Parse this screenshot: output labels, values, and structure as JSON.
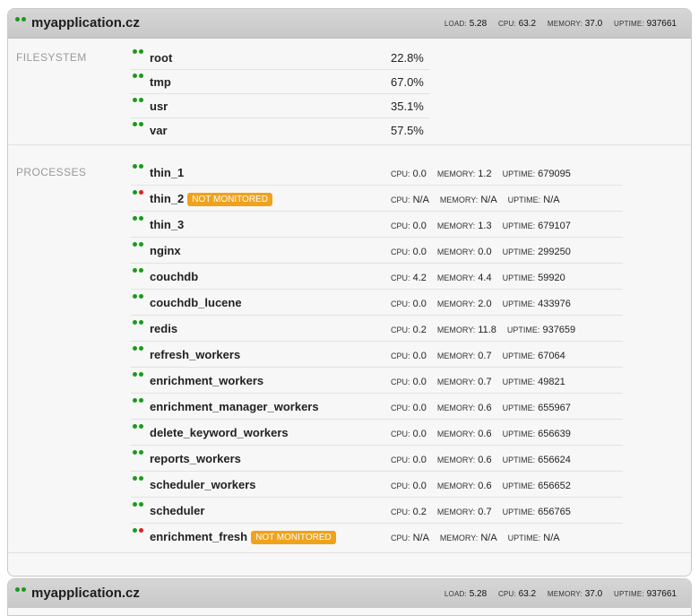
{
  "server": {
    "title": "myapplication.cz",
    "load_label": "LOAD:",
    "load": "5.28",
    "cpu_label": "CPU:",
    "cpu": "63.2",
    "memory_label": "MEMORY:",
    "memory": "37.0",
    "uptime_label": "UPTIME:",
    "uptime": "937661"
  },
  "filesystem": {
    "label": "FILESYSTEM",
    "items": [
      {
        "name": "root",
        "percent": "22.8%"
      },
      {
        "name": "tmp",
        "percent": "67.0%"
      },
      {
        "name": "usr",
        "percent": "35.1%"
      },
      {
        "name": "var",
        "percent": "57.5%"
      }
    ]
  },
  "processes": {
    "label": "PROCESSES",
    "cpu_label": "CPU:",
    "memory_label": "MEMORY:",
    "uptime_label": "UPTIME:",
    "badge_text": "NOT MONITORED",
    "items": [
      {
        "name": "thin_1",
        "status": "ok",
        "cpu": "0.0",
        "memory": "1.2",
        "uptime": "679095"
      },
      {
        "name": "thin_2",
        "status": "not_monitored",
        "cpu": "N/A",
        "memory": "N/A",
        "uptime": "N/A"
      },
      {
        "name": "thin_3",
        "status": "ok",
        "cpu": "0.0",
        "memory": "1.3",
        "uptime": "679107"
      },
      {
        "name": "nginx",
        "status": "ok",
        "cpu": "0.0",
        "memory": "0.0",
        "uptime": "299250"
      },
      {
        "name": "couchdb",
        "status": "ok",
        "cpu": "4.2",
        "memory": "4.4",
        "uptime": "59920"
      },
      {
        "name": "couchdb_lucene",
        "status": "ok",
        "cpu": "0.0",
        "memory": "2.0",
        "uptime": "433976"
      },
      {
        "name": "redis",
        "status": "ok",
        "cpu": "0.2",
        "memory": "11.8",
        "uptime": "937659"
      },
      {
        "name": "refresh_workers",
        "status": "ok",
        "cpu": "0.0",
        "memory": "0.7",
        "uptime": "67064"
      },
      {
        "name": "enrichment_workers",
        "status": "ok",
        "cpu": "0.0",
        "memory": "0.7",
        "uptime": "49821"
      },
      {
        "name": "enrichment_manager_workers",
        "status": "ok",
        "cpu": "0.0",
        "memory": "0.6",
        "uptime": "655967"
      },
      {
        "name": "delete_keyword_workers",
        "status": "ok",
        "cpu": "0.0",
        "memory": "0.6",
        "uptime": "656639"
      },
      {
        "name": "reports_workers",
        "status": "ok",
        "cpu": "0.0",
        "memory": "0.6",
        "uptime": "656624"
      },
      {
        "name": "scheduler_workers",
        "status": "ok",
        "cpu": "0.0",
        "memory": "0.6",
        "uptime": "656652"
      },
      {
        "name": "scheduler",
        "status": "ok",
        "cpu": "0.2",
        "memory": "0.7",
        "uptime": "656765"
      },
      {
        "name": "enrichment_fresh",
        "status": "not_monitored",
        "cpu": "N/A",
        "memory": "N/A",
        "uptime": "N/A"
      }
    ]
  },
  "server2": {
    "title": "myapplication.cz",
    "load_label": "LOAD:",
    "load": "5.28",
    "cpu_label": "CPU:",
    "cpu": "63.2",
    "memory_label": "MEMORY:",
    "memory": "37.0",
    "uptime_label": "UPTIME:",
    "uptime": "937661"
  },
  "colors": {
    "ok": "#1a9a1a",
    "alert": "#e02020",
    "badge": "#f0a21b"
  }
}
